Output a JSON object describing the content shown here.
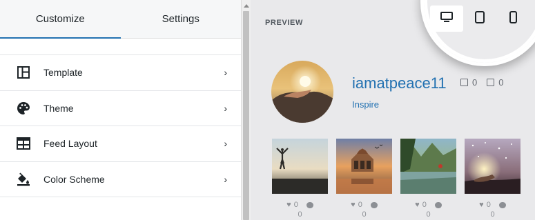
{
  "tabs": [
    {
      "label": "Customize",
      "active": true
    },
    {
      "label": "Settings",
      "active": false
    }
  ],
  "menu": [
    {
      "label": "Template",
      "icon": "template-icon"
    },
    {
      "label": "Theme",
      "icon": "palette-icon"
    },
    {
      "label": "Feed Layout",
      "icon": "feed-layout-icon"
    },
    {
      "label": "Color Scheme",
      "icon": "paint-bucket-icon"
    }
  ],
  "preview": {
    "label": "PREVIEW",
    "username": "iamatpeace11",
    "bio": "Inspire",
    "partial_stats": [
      "0",
      "0"
    ],
    "device_buttons": [
      {
        "icon": "desktop-icon",
        "active": true
      },
      {
        "icon": "tablet-icon",
        "active": false
      },
      {
        "icon": "mobile-icon",
        "active": false
      }
    ],
    "posts": [
      {
        "likes": "0",
        "comments": "0"
      },
      {
        "likes": "0",
        "comments": "0"
      },
      {
        "likes": "0",
        "comments": "0"
      },
      {
        "likes": "0",
        "comments": "0"
      }
    ]
  },
  "colors": {
    "accent": "#2271b1",
    "text": "#1d2327",
    "muted": "#8c8f94"
  }
}
